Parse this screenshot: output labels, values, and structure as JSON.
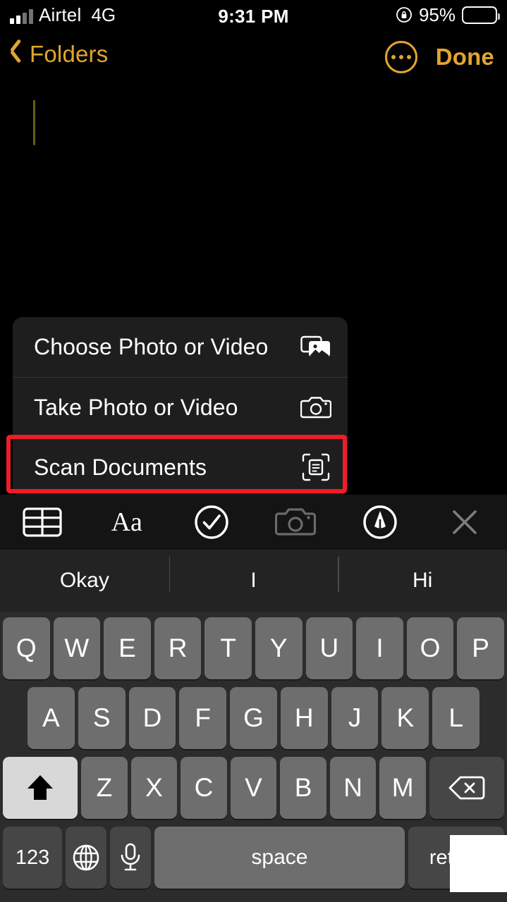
{
  "status_bar": {
    "carrier": "Airtel",
    "network": "4G",
    "time": "9:31 PM",
    "battery_percent": "95%",
    "rotation_lock_icon": "rotation-lock-icon",
    "signal_icon": "signal-bars-icon",
    "battery_icon": "battery-full-icon"
  },
  "nav_bar": {
    "back_label": "Folders",
    "back_icon": "chevron-left-icon",
    "more_icon": "more-options-icon",
    "done_label": "Done"
  },
  "note": {
    "body_text": "",
    "caret": "text-cursor"
  },
  "action_menu": {
    "items": [
      {
        "label": "Choose Photo or Video",
        "icon": "photo-library-icon",
        "highlighted": false
      },
      {
        "label": "Take Photo or Video",
        "icon": "camera-icon",
        "highlighted": false
      },
      {
        "label": "Scan Documents",
        "icon": "document-scanner-icon",
        "highlighted": true
      }
    ]
  },
  "annotation": {
    "color": "#ef1c27",
    "target": "Scan Documents"
  },
  "format_toolbar": {
    "items": [
      {
        "name": "table-icon",
        "label": "",
        "state": "enabled"
      },
      {
        "name": "text-format-icon",
        "label": "Aa",
        "state": "enabled"
      },
      {
        "name": "checklist-icon",
        "label": "",
        "state": "enabled"
      },
      {
        "name": "camera-icon",
        "label": "",
        "state": "active"
      },
      {
        "name": "markup-pen-icon",
        "label": "",
        "state": "enabled"
      },
      {
        "name": "close-icon",
        "label": "",
        "state": "dimmed"
      }
    ]
  },
  "predictive_bar": {
    "suggestions": [
      "Okay",
      "I",
      "Hi"
    ]
  },
  "keyboard": {
    "row1": [
      "Q",
      "W",
      "E",
      "R",
      "T",
      "Y",
      "U",
      "I",
      "O",
      "P"
    ],
    "row2": [
      "A",
      "S",
      "D",
      "F",
      "G",
      "H",
      "J",
      "K",
      "L"
    ],
    "row3_letters": [
      "Z",
      "X",
      "C",
      "V",
      "B",
      "N",
      "M"
    ],
    "shift_icon": "shift-key-icon",
    "backspace_icon": "backspace-key-icon",
    "numbers_label": "123",
    "globe_icon": "globe-key-icon",
    "mic_icon": "microphone-key-icon",
    "space_label": "space",
    "return_label": "return",
    "shift_state": "active"
  },
  "colors": {
    "accent": "#E3A52E",
    "annotation_red": "#ef1c27",
    "menu_bg": "#1e1e1e",
    "keyboard_bg": "#2c2c2c",
    "key_bg": "#6e6e6e",
    "key_dark_bg": "#464646"
  }
}
